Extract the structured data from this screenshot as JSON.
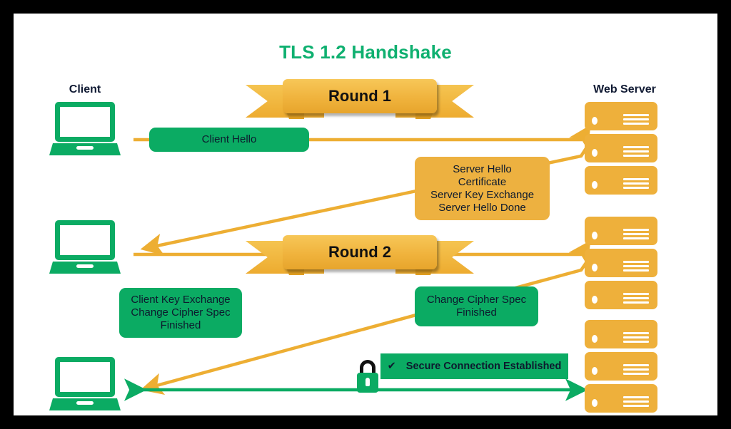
{
  "diagram": {
    "title": "TLS 1.2 Handshake",
    "title_color": "#0fb070",
    "accent_green": "#0bab63",
    "accent_orange": "#edb140",
    "labels": {
      "client": "Client",
      "server": "Web Server"
    },
    "banners": [
      {
        "id": "round1",
        "label": "Round 1"
      },
      {
        "id": "round2",
        "label": "Round 2"
      }
    ],
    "messages": {
      "client_hello": "Client Hello",
      "server_hello_group": {
        "line1": "Server Hello",
        "line2": "Certificate",
        "line3": "Server Key Exchange",
        "line4": "Server Hello Done"
      },
      "client_round2": {
        "line1": "Client Key Exchange",
        "line2": "Change Cipher Spec",
        "line3": "Finished"
      },
      "server_round2": {
        "line1": "Change Cipher Spec",
        "line2": "Finished"
      },
      "secure": {
        "check": "✔",
        "text": "Secure Connection Established"
      }
    }
  }
}
